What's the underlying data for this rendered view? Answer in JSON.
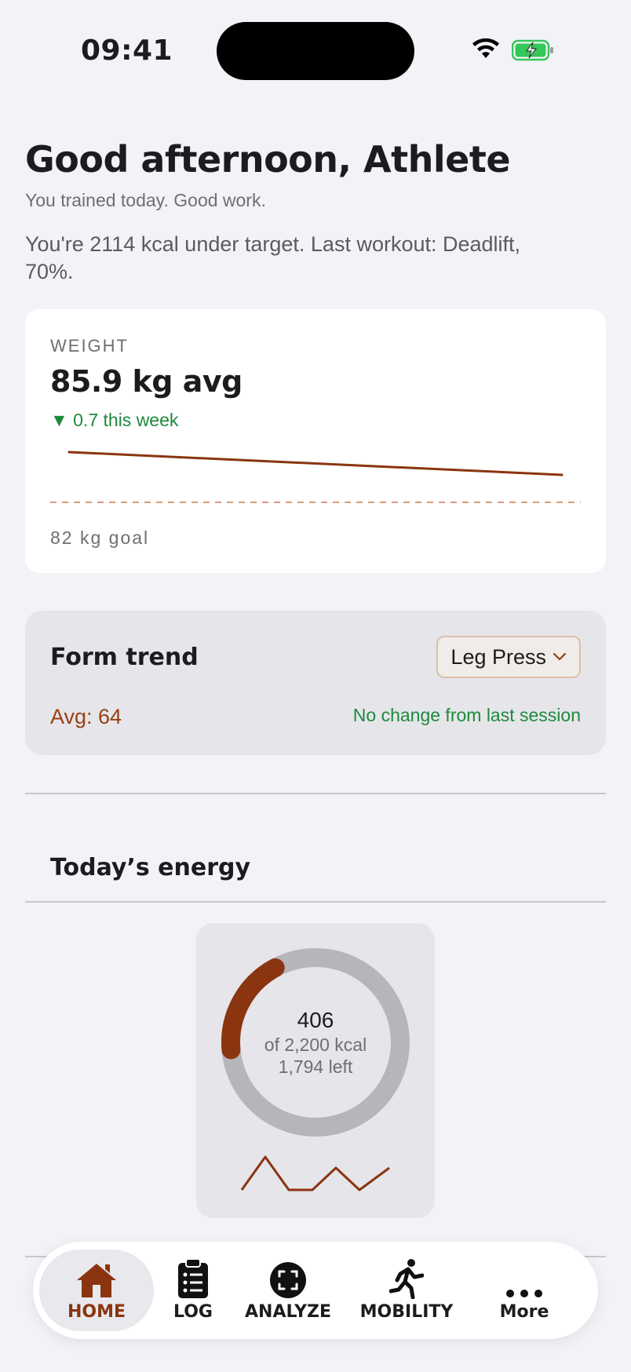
{
  "status_bar": {
    "time": "09:41"
  },
  "header": {
    "greeting": "Good afternoon, Athlete",
    "subtitle": "You trained today. Good work.",
    "summary": "You're 2114 kcal under target. Last workout: Deadlift, 70%."
  },
  "weight_card": {
    "label": "WEIGHT",
    "value": "85.9 kg avg",
    "delta": "▼ 0.7 this week",
    "goal_label": "82 kg goal",
    "chart_data": {
      "type": "line",
      "series_start": 86.3,
      "series_end": 85.6,
      "goal": 82
    }
  },
  "form_card": {
    "title": "Form trend",
    "exercise": "Leg Press",
    "avg": "Avg: 64",
    "change": "No change from last session"
  },
  "energy": {
    "title": "Today’s energy",
    "consumed": "406",
    "target": "of 2,200 kcal",
    "left": "1,794 left",
    "progress": 0.185
  },
  "tabbar": {
    "home": "HOME",
    "log": "LOG",
    "analyze": "ANALYZE",
    "mobility": "MOBILITY",
    "more": "More"
  },
  "colors": {
    "accent": "#9a3f10",
    "positive": "#1e8a3c",
    "background": "#f2f2f7"
  }
}
